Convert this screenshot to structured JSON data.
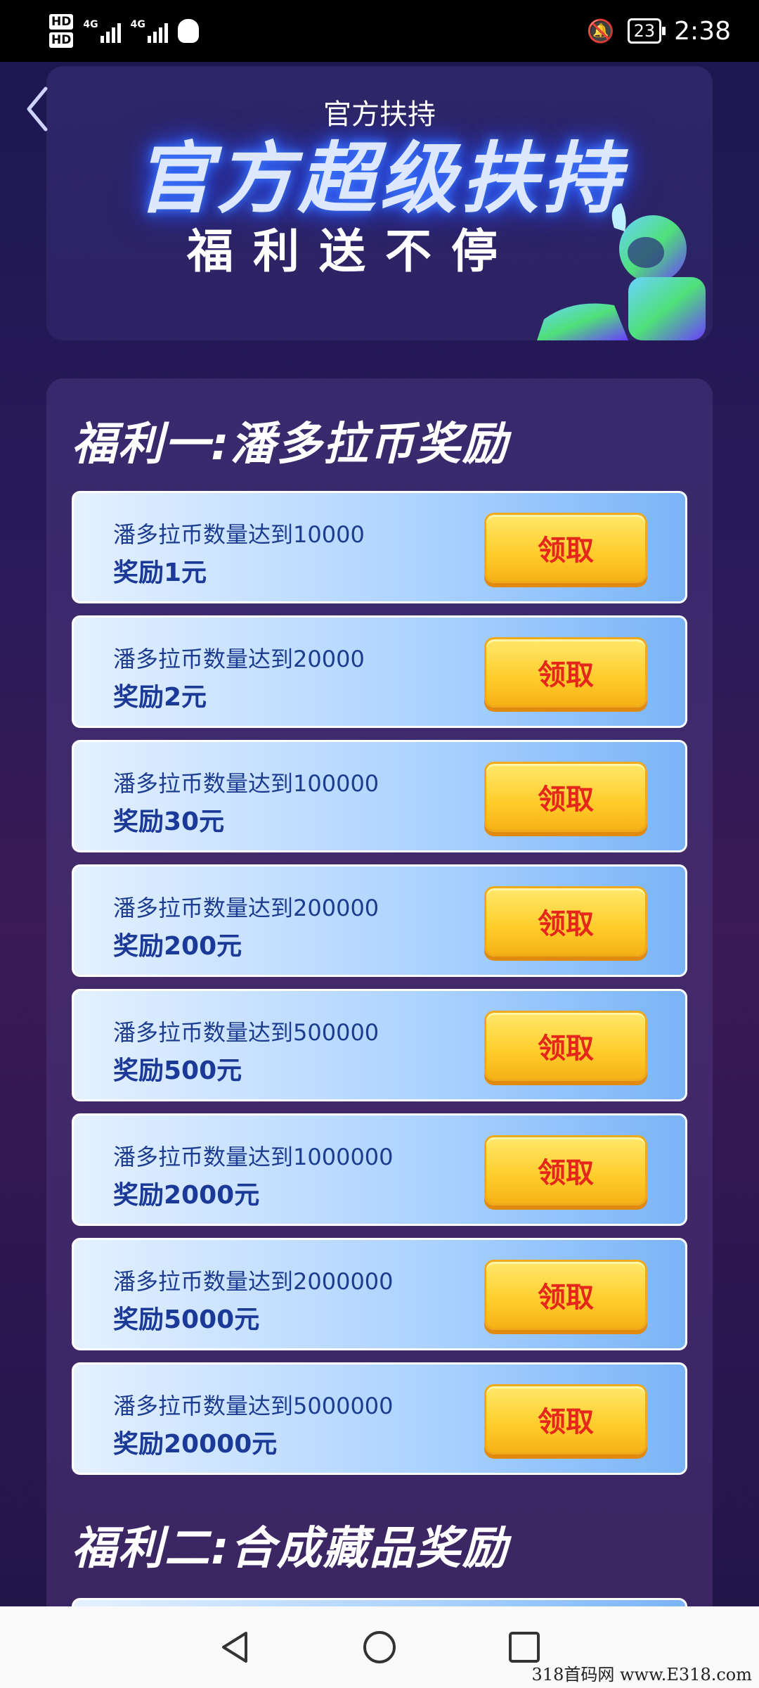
{
  "status_bar": {
    "hd1": "HD",
    "hd2": "HD",
    "net1": "4G",
    "net2": "4G",
    "battery": "23",
    "time": "2:38"
  },
  "header": {
    "nav_title": "官方扶持",
    "banner_title": "官方超级扶持",
    "banner_subtitle": "福利送不停"
  },
  "sections": [
    {
      "title": "福利一:潘多拉币奖励",
      "rows": [
        {
          "condition": "潘多拉币数量达到10000",
          "reward": "奖励1元",
          "button": "领取"
        },
        {
          "condition": "潘多拉币数量达到20000",
          "reward": "奖励2元",
          "button": "领取"
        },
        {
          "condition": "潘多拉币数量达到100000",
          "reward": "奖励30元",
          "button": "领取"
        },
        {
          "condition": "潘多拉币数量达到200000",
          "reward": "奖励200元",
          "button": "领取"
        },
        {
          "condition": "潘多拉币数量达到500000",
          "reward": "奖励500元",
          "button": "领取"
        },
        {
          "condition": "潘多拉币数量达到1000000",
          "reward": "奖励2000元",
          "button": "领取"
        },
        {
          "condition": "潘多拉币数量达到2000000",
          "reward": "奖励5000元",
          "button": "领取"
        },
        {
          "condition": "潘多拉币数量达到5000000",
          "reward": "奖励20000元",
          "button": "领取"
        }
      ]
    },
    {
      "title": "福利二:合成藏品奖励"
    }
  ],
  "watermark": "318首码网 www.E318.com"
}
